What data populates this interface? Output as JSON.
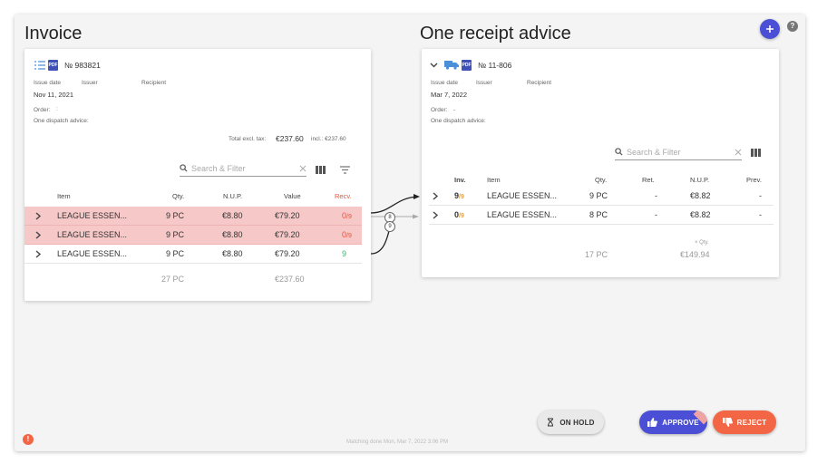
{
  "invoice": {
    "section_title": "Invoice",
    "number": "№ 983821",
    "labels": {
      "issue_date": "Issue date",
      "issuer": "Issuer",
      "recipient": "Recipient",
      "order": "Order:",
      "dispatch": "One dispatch advice:"
    },
    "issue_date": "Nov 11, 2021",
    "order_value": ":",
    "total_excl_label": "Total excl. tax:",
    "total_excl": "€237.60",
    "total_incl": "incl.: €237.60",
    "search_placeholder": "Search & Filter",
    "columns": {
      "item": "Item",
      "qty": "Qty.",
      "nup": "N.U.P.",
      "value": "Value",
      "recv": "Recv."
    },
    "rows": [
      {
        "item": "LEAGUE ESSEN...",
        "qty": "9 PC",
        "nup": "€8.80",
        "value": "€79.20",
        "recv": "0",
        "recv_frac": "/9",
        "status": "alert"
      },
      {
        "item": "LEAGUE ESSEN...",
        "qty": "9 PC",
        "nup": "€8.80",
        "value": "€79.20",
        "recv": "0",
        "recv_frac": "/9",
        "status": "alert"
      },
      {
        "item": "LEAGUE ESSEN...",
        "qty": "9 PC",
        "nup": "€8.80",
        "value": "€79.20",
        "recv": "9",
        "recv_frac": "",
        "status": "ok"
      }
    ],
    "footer": {
      "qty": "27 PC",
      "value": "€237.60"
    }
  },
  "receipt": {
    "section_title": "One receipt advice",
    "number": "№ 11-806",
    "labels": {
      "issue_date": "Issue date",
      "issuer": "Issuer",
      "recipient": "Recipient",
      "order": "Order:",
      "dispatch": "One dispatch advice:"
    },
    "issue_date": "Mar 7, 2022",
    "order_value": "-",
    "search_placeholder": "Search & Filter",
    "columns": {
      "inv": "Inv.",
      "item": "Item",
      "qty": "Qty.",
      "ret": "Ret.",
      "nup": "N.U.P.",
      "prev": "Prev."
    },
    "rows": [
      {
        "inv": "9",
        "inv_frac": "/9",
        "item": "LEAGUE ESSEN...",
        "qty": "9 PC",
        "ret": "-",
        "nup": "€8.82",
        "prev": "-"
      },
      {
        "inv": "0",
        "inv_frac": "/9",
        "item": "LEAGUE ESSEN...",
        "qty": "8 PC",
        "ret": "-",
        "nup": "€8.82",
        "prev": "-"
      }
    ],
    "footer": {
      "qty_label": "× Qty.",
      "qty": "17 PC",
      "value": "€149.94"
    }
  },
  "connectors": {
    "badge_a": "8",
    "badge_b": "9"
  },
  "actions": {
    "on_hold": "ON HOLD",
    "approve": "APPROVE",
    "reject": "REJECT"
  },
  "status_text": "Matching done Mon, Mar 7, 2022 3:06 PM",
  "help": "?",
  "alert": "!",
  "colors": {
    "accent": "#4a4fd6",
    "reject": "#f26545",
    "alert_row": "#f6c8c8"
  }
}
